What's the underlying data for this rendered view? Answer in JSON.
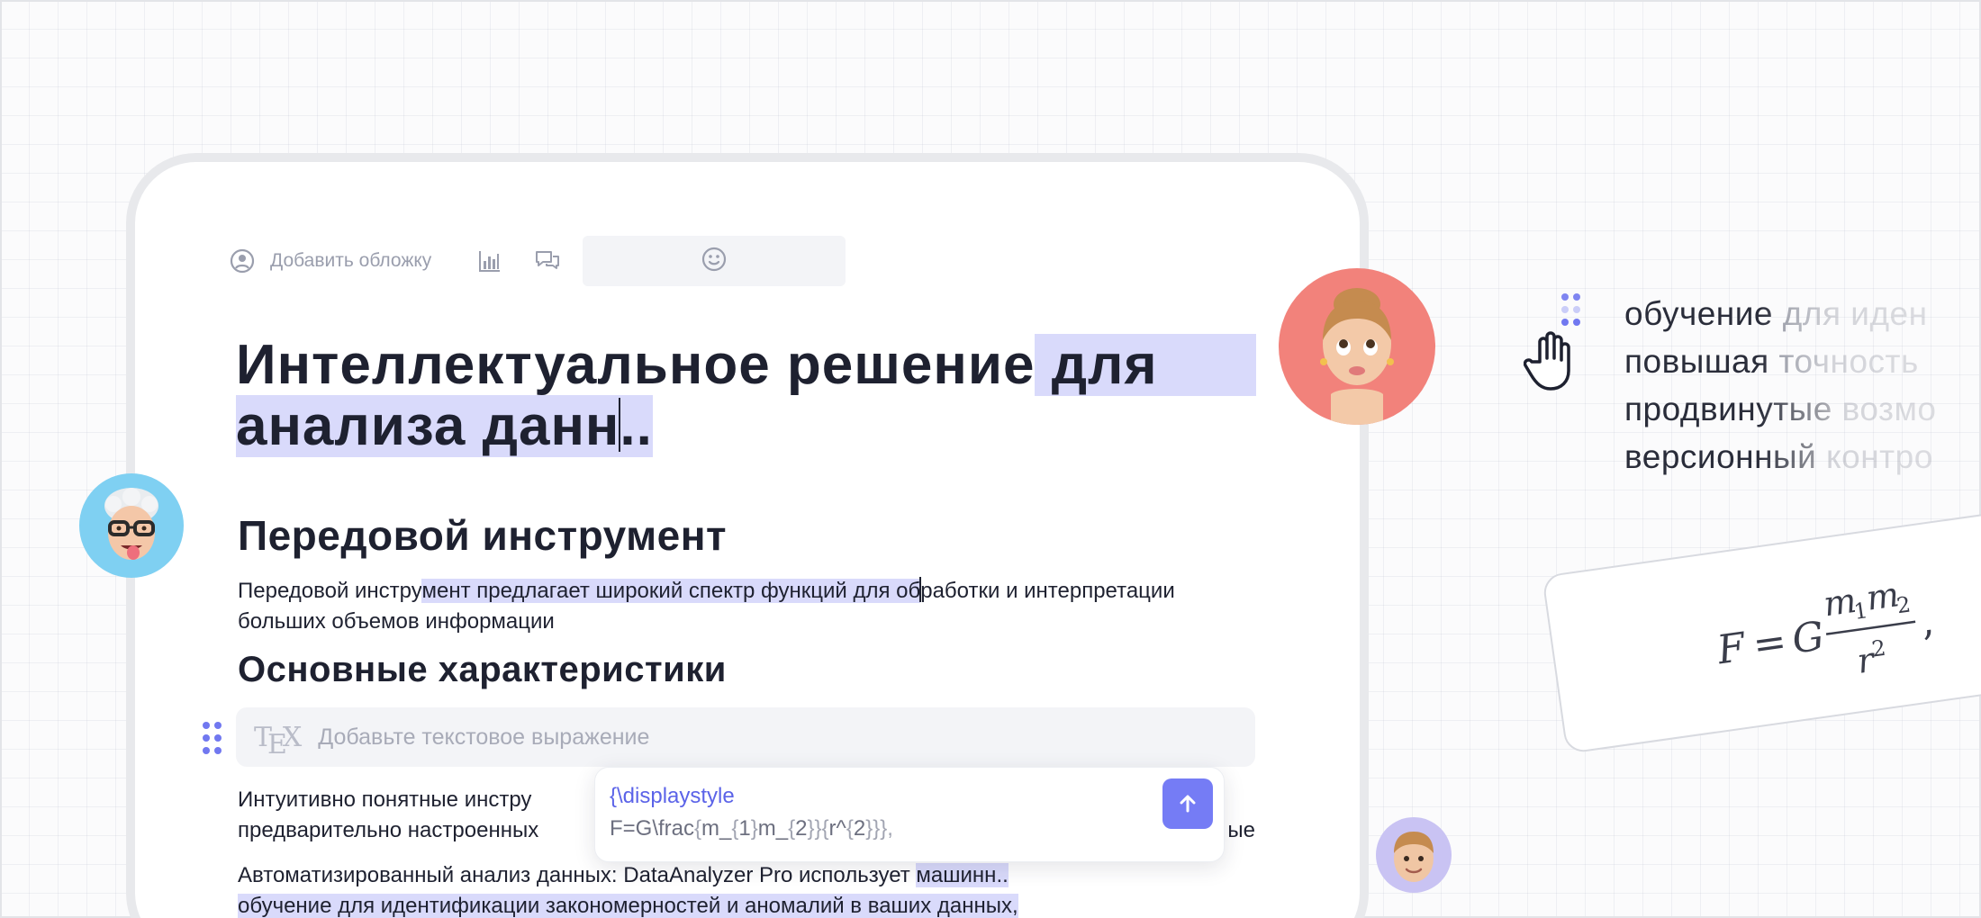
{
  "toolbar": {
    "add_cover_label": "Добавить обложку",
    "icons": [
      "user-circle-icon",
      "chart-icon",
      "comments-icon",
      "smile-icon"
    ]
  },
  "document": {
    "title_plain": "Интеллектуальное решение",
    "title_highlight_1": " для",
    "title_highlight_2": "анализа данн",
    "title_highlight_3": "..",
    "heading_1": "Передовой инструмент",
    "paragraph_1": {
      "part_1": "Передовой инстру",
      "part_2": "мент предлагает широкий спектр функций для об",
      "part_3": "работки и интерпретации больших объемов информации"
    },
    "heading_2": "Основные характеристики",
    "tex_block": {
      "logo": "TEX",
      "placeholder": "Добавьте текстовое выражение"
    },
    "paragraph_2": {
      "line_1": " Интуитивно понятные инстру",
      "line_2_start": "предварительно настроенных",
      "line_2_end": "ые"
    },
    "paragraph_3": {
      "part_1": "Автоматизированный анализ данных: DataAnalyzer Pro использует ",
      "part_2": "машинн..",
      "part_3": "обучение для идентификации закономерностей и аномалий в ваших данных,"
    }
  },
  "formula_popup": {
    "line_1": "{\\displaystyle",
    "line_2_parts": [
      "F=G\\frac",
      "{",
      "m_",
      "{",
      "1",
      "}",
      "m_",
      "{",
      "2",
      "}}",
      "{",
      "r^",
      "{",
      "2",
      "}}},"
    ],
    "submit_icon": "arrow-up-icon"
  },
  "side_snippet": {
    "lines": [
      {
        "dark": "обучение",
        "light": " для иден"
      },
      {
        "dark": "повышая",
        "light": " точность"
      },
      {
        "dark": "продвинутые",
        "light": " возмо"
      },
      {
        "dark": "версионный",
        "light": " контро"
      }
    ],
    "cursor_icon": "hand-cursor-icon"
  },
  "rendered_formula": "F = G m1m2 / r2,",
  "colors": {
    "accent": "#757cf5",
    "highlight": "#d9dafb",
    "avatar_blue": "#7fd0f2",
    "avatar_red": "#f2827b",
    "avatar_purple": "#c9c3f3"
  }
}
